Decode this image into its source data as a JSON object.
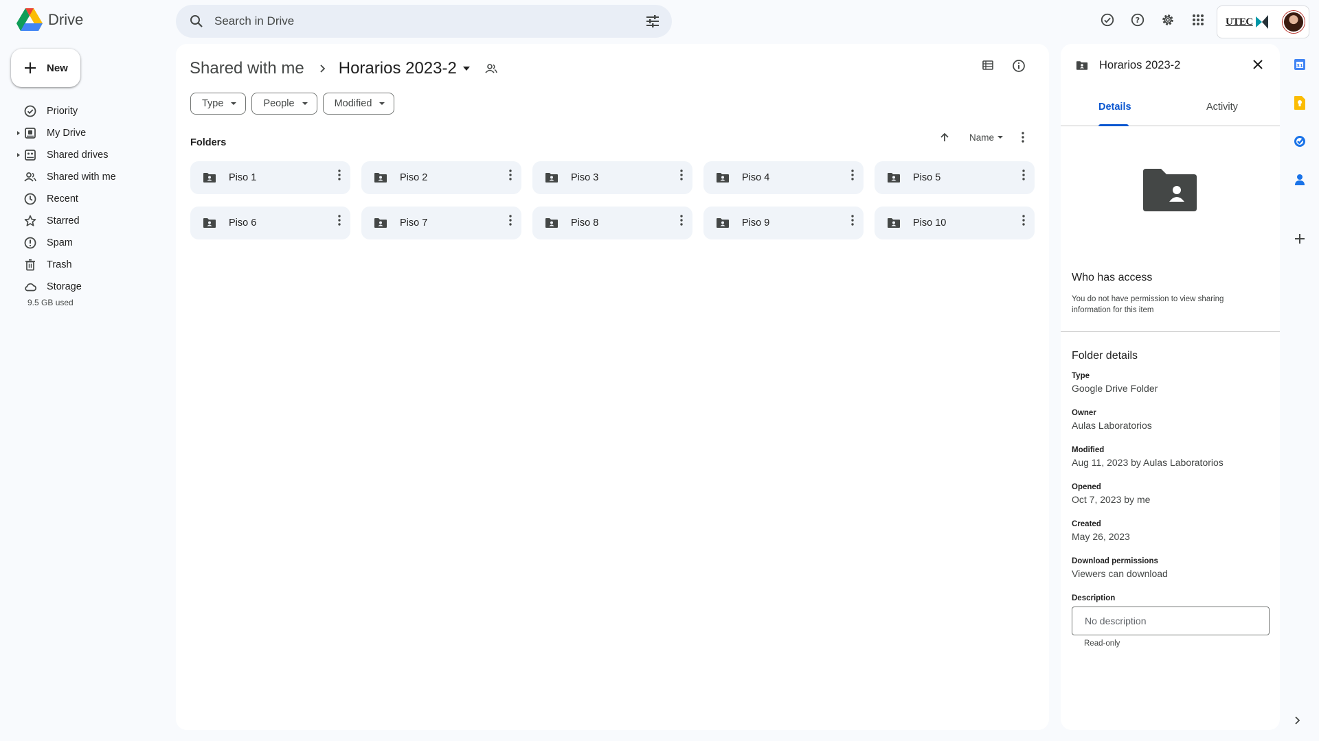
{
  "app": {
    "name": "Drive"
  },
  "search": {
    "placeholder": "Search in Drive"
  },
  "account": {
    "org_label": "UTEC"
  },
  "sidebar": {
    "new_label": "New",
    "items": [
      {
        "label": "Priority",
        "icon": "priority-icon",
        "caret": false
      },
      {
        "label": "My Drive",
        "icon": "my-drive-icon",
        "caret": true
      },
      {
        "label": "Shared drives",
        "icon": "shared-drives-icon",
        "caret": true
      },
      {
        "label": "Shared with me",
        "icon": "shared-with-me-icon",
        "caret": false
      },
      {
        "label": "Recent",
        "icon": "clock-icon",
        "caret": false
      },
      {
        "label": "Starred",
        "icon": "star-icon",
        "caret": false
      },
      {
        "label": "Spam",
        "icon": "spam-icon",
        "caret": false
      },
      {
        "label": "Trash",
        "icon": "trash-icon",
        "caret": false
      },
      {
        "label": "Storage",
        "icon": "cloud-icon",
        "caret": false
      }
    ],
    "storage_used": "9.5 GB used"
  },
  "main": {
    "breadcrumb_root": "Shared with me",
    "breadcrumb_current": "Horarios 2023-2",
    "filters": [
      "Type",
      "People",
      "Modified"
    ],
    "section_title": "Folders",
    "sort_label": "Name",
    "folders": [
      "Piso 1",
      "Piso 2",
      "Piso 3",
      "Piso 4",
      "Piso 5",
      "Piso 6",
      "Piso 7",
      "Piso 8",
      "Piso 9",
      "Piso 10"
    ]
  },
  "details": {
    "title": "Horarios 2023-2",
    "tabs": [
      "Details",
      "Activity"
    ],
    "active_tab": "Details",
    "access_title": "Who has access",
    "access_text": "You do not have permission to view sharing information for this item",
    "folder_details_title": "Folder details",
    "props": [
      {
        "label": "Type",
        "value": "Google Drive Folder"
      },
      {
        "label": "Owner",
        "value": "Aulas Laboratorios"
      },
      {
        "label": "Modified",
        "value": "Aug 11, 2023 by Aulas Laboratorios"
      },
      {
        "label": "Opened",
        "value": "Oct 7, 2023 by me"
      },
      {
        "label": "Created",
        "value": "May 26, 2023"
      },
      {
        "label": "Download permissions",
        "value": "Viewers can download"
      },
      {
        "label": "Description",
        "value": ""
      }
    ],
    "description_placeholder": "No description",
    "read_only": "Read-only"
  },
  "colors": {
    "accent": "#0b57d0",
    "background": "#f8fafd",
    "folder_tile": "#f0f4f9"
  }
}
